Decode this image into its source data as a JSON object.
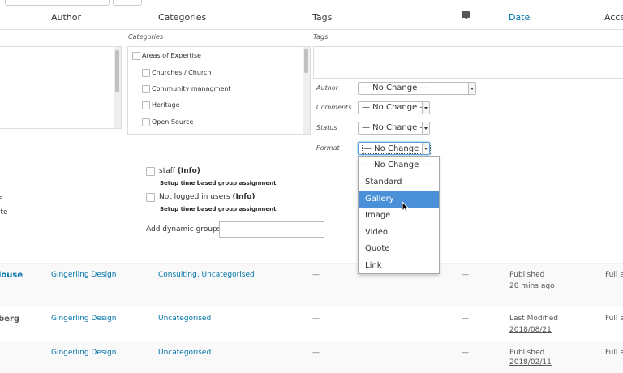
{
  "header": {
    "col_author": "Author",
    "col_categories": "Categories",
    "col_tags": "Tags",
    "col_comments_icon": "comment-bubble-icon",
    "col_date": "Date",
    "col_access": "Acces"
  },
  "bulk_edit": {
    "categories_label": "Categories",
    "tags_label": "Tags",
    "categories": [
      {
        "label": "Areas of Expertise",
        "level": 0
      },
      {
        "label": "Churches / Church",
        "level": 1
      },
      {
        "label": "Community managment",
        "level": 1
      },
      {
        "label": "Heritage",
        "level": 1
      },
      {
        "label": "Open Source",
        "level": 1
      }
    ],
    "fields": {
      "author_label": "Author",
      "author_value": "— No Change —",
      "comments_label": "Comments",
      "comments_value": "— No Change —",
      "status_label": "Status",
      "status_value": "— No Change —",
      "format_label": "Format",
      "format_value": "— No Change —"
    },
    "format_options": [
      "— No Change —",
      "Standard",
      "Gallery",
      "Image",
      "Video",
      "Quote",
      "Link"
    ],
    "format_highlighted": "Gallery",
    "groups": [
      {
        "name": "staff",
        "info": "(Info)",
        "sub": "Setup time based group assignment"
      },
      {
        "name": "Not logged in users",
        "info": "(Info)",
        "sub": "Setup time based group assignment"
      }
    ],
    "dynamic_groups_label": "Add dynamic groups",
    "left_clipped_1": "e",
    "left_clipped_2": "ite"
  },
  "rows": [
    {
      "title": "louse",
      "author": "Gingerling Design",
      "categories": "Consulting, Uncategorised",
      "tags": "—",
      "comments": "—",
      "status": "Published",
      "date": "20 mins ago",
      "access": "Full ac"
    },
    {
      "title": "berg",
      "author": "Gingerling Design",
      "categories": "Uncategorised",
      "tags": "—",
      "comments": "—",
      "status": "Last Modified",
      "date": "2018/08/21",
      "access": "Full ac"
    },
    {
      "title": "",
      "author": "Gingerling Design",
      "categories": "Uncategorised",
      "tags": "—",
      "comments": "—",
      "status": "Published",
      "date": "2018/02/11",
      "access": "Full ac"
    }
  ]
}
